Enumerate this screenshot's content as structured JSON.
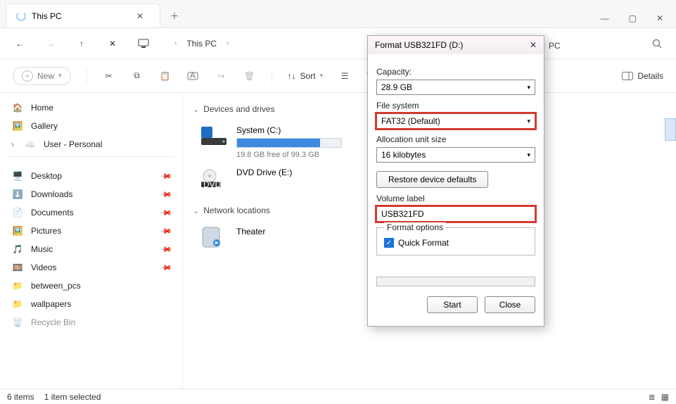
{
  "window": {
    "tab_title": "This PC",
    "controls": {
      "min": "—",
      "max": "▢",
      "close": "✕"
    }
  },
  "nav": {
    "crumbs": [
      "This PC"
    ],
    "crumb_trail": "PC"
  },
  "toolbar": {
    "new_label": "New",
    "sort_label": "Sort",
    "view_cut": "V",
    "details_label": "Details"
  },
  "sidebar": {
    "main": [
      {
        "icon": "🏠",
        "label": "Home"
      },
      {
        "icon": "🖼️",
        "label": "Gallery"
      },
      {
        "icon": "☁️",
        "label": "User - Personal",
        "expandable": true
      }
    ],
    "quick": [
      {
        "icon": "🖥️",
        "label": "Desktop",
        "pinned": true
      },
      {
        "icon": "⬇️",
        "label": "Downloads",
        "pinned": true
      },
      {
        "icon": "📄",
        "label": "Documents",
        "pinned": true
      },
      {
        "icon": "🖼️",
        "label": "Pictures",
        "pinned": true
      },
      {
        "icon": "🎵",
        "label": "Music",
        "pinned": true
      },
      {
        "icon": "🎞️",
        "label": "Videos",
        "pinned": true
      },
      {
        "icon": "📁",
        "label": "between_pcs"
      },
      {
        "icon": "📁",
        "label": "wallpapers"
      },
      {
        "icon": "🗑️",
        "label": "Recycle Bin"
      }
    ]
  },
  "content": {
    "sections": {
      "devices_hdr": "Devices and drives",
      "network_hdr": "Network locations"
    },
    "drives": [
      {
        "name": "System (C:)",
        "free_text": "19.8 GB free of 99.3 GB",
        "fill_pct": 80
      },
      {
        "name": "DVD Drive (E:)"
      }
    ],
    "network": [
      {
        "name": "Theater"
      }
    ]
  },
  "dialog": {
    "title": "Format USB321FD (D:)",
    "capacity_label": "Capacity:",
    "capacity_value": "28.9 GB",
    "fs_label": "File system",
    "fs_value": "FAT32 (Default)",
    "alloc_label": "Allocation unit size",
    "alloc_value": "16 kilobytes",
    "restore_label": "Restore device defaults",
    "vol_label": "Volume label",
    "vol_value": "USB321FD",
    "opts_legend": "Format options",
    "quick_label": "Quick Format",
    "start_label": "Start",
    "close_label": "Close"
  },
  "status": {
    "items": "6 items",
    "selected": "1 item selected"
  }
}
